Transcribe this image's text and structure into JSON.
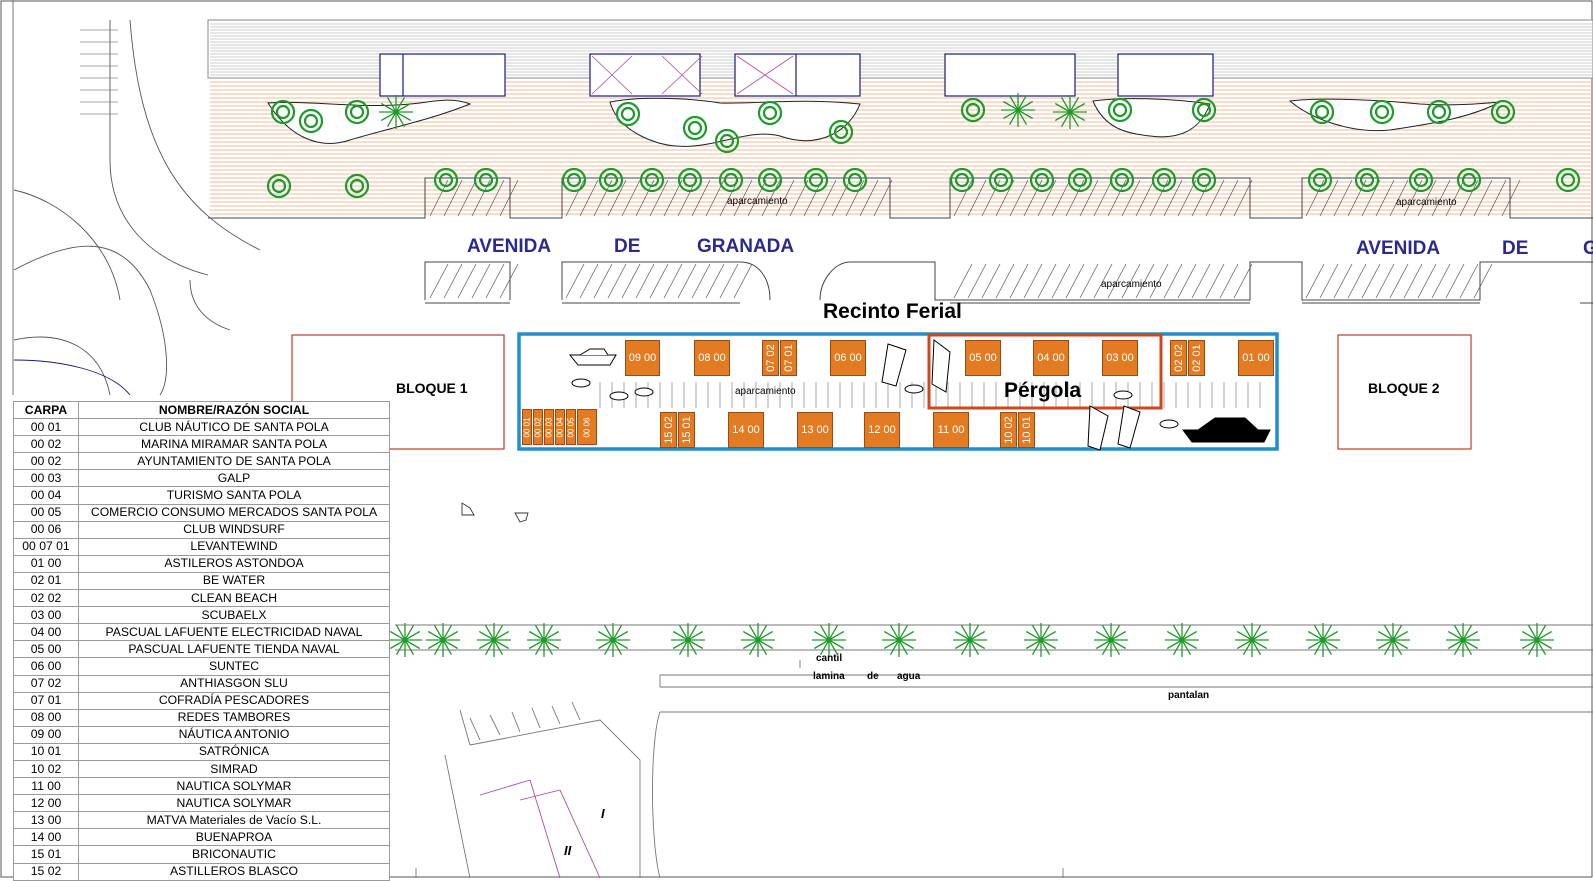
{
  "labels": {
    "street_1": [
      "AVENIDA",
      "DE",
      "GRANADA"
    ],
    "street_2": [
      "AVENIDA",
      "DE",
      "G"
    ],
    "parking": "aparcamiento",
    "venue_title": "Recinto Ferial",
    "pergola": "Pérgola",
    "block_1": "BLOQUE 1",
    "block_2": "BLOQUE 2",
    "cantil": "cantil",
    "water": [
      "lamina",
      "de",
      "agua"
    ],
    "pier": "pantalan",
    "building_marks": [
      "I",
      "II"
    ]
  },
  "tents_top": [
    "09 00",
    "08 00",
    "07 02",
    "07 01",
    "06 00",
    "05 00",
    "04 00",
    "03 00",
    "02 02",
    "02 01",
    "01 00"
  ],
  "tents_bottom": [
    "00 01",
    "00 02",
    "00 03",
    "00 04",
    "00 05",
    "00 06",
    "15 02",
    "15 01",
    "14 00",
    "13 00",
    "12 00",
    "11 00",
    "10 02",
    "10 01"
  ],
  "legend": {
    "headers": [
      "CARPA",
      "NOMBRE/RAZÓN SOCIAL"
    ],
    "rows": [
      [
        "00 01",
        "CLUB NÁUTICO DE SANTA POLA"
      ],
      [
        "00 02",
        "MARINA MIRAMAR SANTA POLA"
      ],
      [
        "00 02",
        "AYUNTAMIENTO DE SANTA POLA"
      ],
      [
        "00 03",
        "GALP"
      ],
      [
        "00 04",
        "TURISMO SANTA POLA"
      ],
      [
        "00 05",
        "COMERCIO CONSUMO MERCADOS SANTA POLA"
      ],
      [
        "00 06",
        "CLUB WINDSURF"
      ],
      [
        "00 07 01",
        "LEVANTEWIND"
      ],
      [
        "01 00",
        "ASTILEROS ASTONDOA"
      ],
      [
        "02 01",
        "BE WATER"
      ],
      [
        "02 02",
        "CLEAN BEACH"
      ],
      [
        "03 00",
        "SCUBAELX"
      ],
      [
        "04 00",
        "PASCUAL LAFUENTE ELECTRICIDAD NAVAL"
      ],
      [
        "05 00",
        "PASCUAL LAFUENTE TIENDA NAVAL"
      ],
      [
        "06 00",
        "SUNTEC"
      ],
      [
        "07 02",
        "ANTHIASGON SLU"
      ],
      [
        "07 01",
        "COFRADÍA PESCADORES"
      ],
      [
        "08 00",
        "REDES TAMBORES"
      ],
      [
        "09 00",
        "NÁUTICA ANTONIO"
      ],
      [
        "10 01",
        "SATRÓNICA"
      ],
      [
        "10 02",
        "SIMRAD"
      ],
      [
        "11 00",
        "NAUTICA SOLYMAR"
      ],
      [
        "12 00",
        "NAUTICA SOLYMAR"
      ],
      [
        "13 00",
        "MATVA Materiales de Vacío S.L."
      ],
      [
        "14 00",
        "BUENAPROA"
      ],
      [
        "15 01",
        "BRICONAUTIC"
      ],
      [
        "15 02",
        "ASTILLEROS BLASCO"
      ]
    ]
  },
  "colors": {
    "street": "#2b2a8c",
    "tent": "#e27b22",
    "venue_border": "#1f8fcf",
    "pergola_border": "#d2451d",
    "trees": "#1e9a2a",
    "boardwalk": "#e8a57a",
    "block_border": "#c0392b"
  }
}
